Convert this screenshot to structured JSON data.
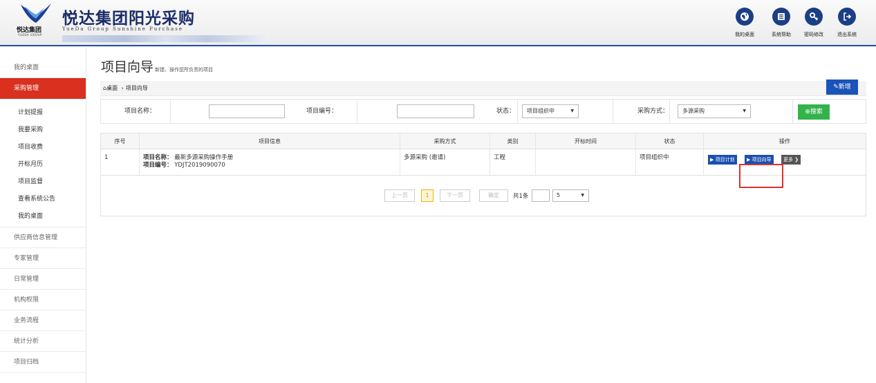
{
  "header": {
    "logo_text": "悦达集团",
    "logo_sub": "YUEDA GROUP",
    "title": "悦达集团阳光采购",
    "subtitle": "YueDa Group Sunshine Purchase",
    "buttons": [
      {
        "label": "我的桌面",
        "icon": "globe-icon"
      },
      {
        "label": "系统帮助",
        "icon": "list-icon"
      },
      {
        "label": "密码修改",
        "icon": "key-icon"
      },
      {
        "label": "退出系统",
        "icon": "logout-icon"
      }
    ],
    "colors": {
      "brand": "#1b2c6a",
      "icon_bg": "#1b3f86"
    }
  },
  "sidebar": {
    "items": [
      {
        "label": "我的桌面"
      },
      {
        "label": "采购管理",
        "active": true
      },
      {
        "label": "供应商信息管理"
      },
      {
        "label": "专家管理"
      },
      {
        "label": "日常管理"
      },
      {
        "label": "机构权限"
      },
      {
        "label": "业务流程"
      },
      {
        "label": "统计分析"
      },
      {
        "label": "项目归档"
      }
    ],
    "sub_items": [
      "计划提报",
      "我要采购",
      "项目收费",
      "开标月历",
      "项目监督",
      "查看系统公告",
      "我的桌面"
    ],
    "active_color": "#d9301f"
  },
  "page": {
    "title": "项目向导",
    "description": "新建、操作您所负责的项目",
    "breadcrumb_home": "桌面",
    "breadcrumb_sep": "›",
    "breadcrumb_current": "项目向导",
    "new_button": "新增"
  },
  "filter": {
    "name_label": "项目名称：",
    "name_value": "",
    "code_label": "项目编号：",
    "code_value": "",
    "status_label": "状态：",
    "status_value": "项目组织中",
    "method_label": "采购方式：",
    "method_value": "多源采购",
    "search_button": "搜索"
  },
  "table": {
    "headers": [
      "序号",
      "项目信息",
      "采购方式",
      "类别",
      "开标时间",
      "状态",
      "操作"
    ],
    "rows": [
      {
        "index": "1",
        "name_label": "项目名称：",
        "name": "最新多源采购操作手册",
        "code_label": "项目编号：",
        "code": "YDJT2019090070",
        "method": "多源采购 (邀请)",
        "category": "工程",
        "open_time": "",
        "status": "项目组织中",
        "actions": [
          "项目计划",
          "项目向导",
          "更多"
        ]
      }
    ]
  },
  "pager": {
    "prev": "上一页",
    "current": "1",
    "next": "下一页",
    "confirm": "确定",
    "total": "共1条",
    "page_input": "",
    "page_size": "5"
  }
}
